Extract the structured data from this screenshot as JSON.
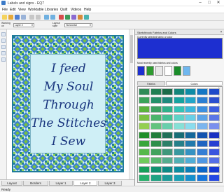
{
  "window": {
    "title": "Labels and signs - EQ7",
    "minimize": "–",
    "maximize": "□",
    "close": "✕"
  },
  "menu": [
    "File",
    "Edit",
    "View",
    "Worktable",
    "Libraries",
    "Quilt",
    "Videos",
    "Help"
  ],
  "toolbar": {
    "working_on_label": "Working on",
    "layer_value": "Layer 2",
    "layout_label": "Layout style",
    "layout_value": "Horizontal"
  },
  "quilt": {
    "lines": [
      "I feed",
      "My Soul",
      "Through",
      "The Stitches",
      "I Sew"
    ],
    "text_color": "#17337d",
    "background": "#cfeff6"
  },
  "tabs": [
    "Layout",
    "Borders",
    "Layer 1",
    "Layer 2",
    "Layer 3"
  ],
  "active_tab": "Layer 2",
  "status": "Ready",
  "panel": {
    "title": "Sketchbook Fabrics and Colors",
    "current_label": "Currently selected fabric or color",
    "current_color": "#1d2fd0",
    "recent_label": "Most recently used fabrics and colors",
    "recent_colors": [
      "#1d2fd0",
      "#2d9a2f",
      "#e8e8e8",
      "#ffffff",
      "#1a8c2a",
      "#6fb7ef"
    ],
    "subtabs": [
      "Fabrics",
      "Colors"
    ],
    "active_subtab": "Colors"
  },
  "palette_colors": [
    [
      "#2e8b57",
      "#1f7f52",
      "#1c6b49",
      "#14857a",
      "#0f8ca6",
      "#1577c4",
      "#1d49c9"
    ],
    [
      "#3aa35a",
      "#23906a",
      "#1e8a7e",
      "#16a3a0",
      "#23a6c9",
      "#2b7fd3",
      "#2b4fcf"
    ],
    [
      "#5ab33d",
      "#3aa060",
      "#2fb08a",
      "#34c3b6",
      "#3bb8dc",
      "#3b8fe0",
      "#3d5ee0"
    ],
    [
      "#7ac142",
      "#4bb46b",
      "#44c095",
      "#5fd3c7",
      "#69cfe7",
      "#5ba3e8",
      "#5a76e6"
    ],
    [
      "#94cf51",
      "#63c37e",
      "#68cfac",
      "#86e0d6",
      "#8adcee",
      "#7bb5ee",
      "#7a8fee"
    ],
    [
      "#1f8f2a",
      "#207d3a",
      "#1f6f57",
      "#176d75",
      "#14689b",
      "#1354b0",
      "#1a31c2"
    ],
    [
      "#39a63a",
      "#2e8f4b",
      "#2c8068",
      "#257f89",
      "#2179ac",
      "#1f64c1",
      "#2640d2"
    ],
    [
      "#55b84a",
      "#41a35d",
      "#3f977b",
      "#39989f",
      "#3592c2",
      "#357ed4",
      "#3a55de"
    ],
    [
      "#6fcb5c",
      "#56b86f",
      "#55ac8f",
      "#52b0b5",
      "#50aed7",
      "#4f97e3",
      "#546ee7"
    ],
    [
      "#16a05a",
      "#0f9270",
      "#0e8a86",
      "#0b8da0",
      "#0a7fb8",
      "#0a66c8",
      "#1638d4"
    ],
    [
      "#27b06b",
      "#1ea282",
      "#1c9b99",
      "#18a0b5",
      "#168fcd",
      "#1575dc",
      "#2448e3"
    ]
  ]
}
